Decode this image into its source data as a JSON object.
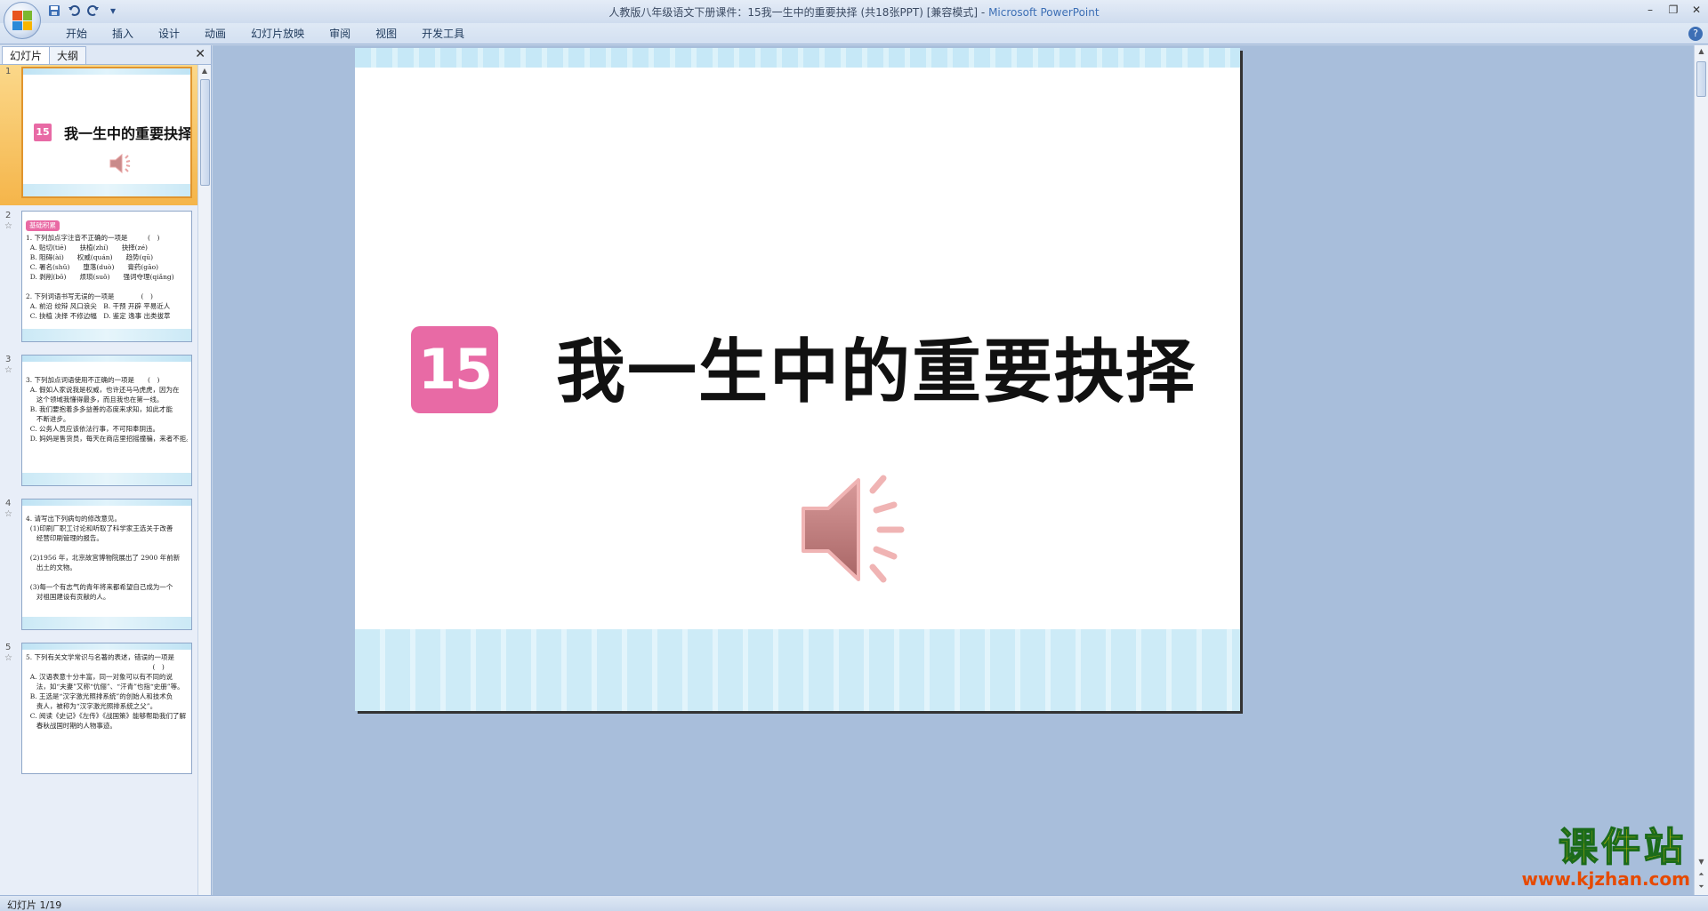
{
  "window": {
    "title": "人教版八年级语文下册课件：15我一生中的重要抉择 (共18张PPT) [兼容模式] - ",
    "app_name": "Microsoft PowerPoint"
  },
  "quick_access": {
    "save_icon": "save-icon",
    "undo_icon": "undo-icon",
    "redo_icon": "redo-icon",
    "customize_icon": "dropdown-icon"
  },
  "ribbon": {
    "tabs": [
      "开始",
      "插入",
      "设计",
      "动画",
      "幻灯片放映",
      "审阅",
      "视图",
      "开发工具"
    ],
    "help": "?"
  },
  "panel": {
    "tabs": [
      "幻灯片",
      "大纲"
    ],
    "close": "✕"
  },
  "thumbnails": [
    {
      "num": "1",
      "title_num": "15",
      "title": "我一生中的重要抉择"
    },
    {
      "num": "2",
      "badge": "基础积累",
      "text": "1. 下列加点字注音不正确的一项是　　　(　)\n  A. 贴切(tiē)　　扶植(zhí)　　抉择(zé)\n  B. 阻碍(ài)　　权威(quán)　　趋势(qū)\n  C. 署名(shǔ)　　堕落(duò)　　膏药(gāo)\n  D. 剥削(bō)　　烦琐(suǒ)　　强词夺理(qiǎng)\n\n2. 下列词语书写无误的一项是　　　　(　)\n  A. 前沿 绞辩 风口浪尖　B. 干预 开辟 平易近人\n  C. 抉植 决择 不修边幅　D. 鉴定 逸事 出类拔萃"
    },
    {
      "num": "3",
      "text": "3. 下列加点词语使用不正确的一项是　　(　)\n  A. 假如人家说我是权威，也许还马马虎虎，因为在\n     这个领域我懂得最多，而且我也在第一线。\n  B. 我们要抱着多多益善的态度来求知，如此才能\n     不断进步。\n  C. 公务人员应该依法行事，不可阳奉阴违。\n  D. 妈妈是售货员，每天在商店里招摇撞骗，来者不拒。"
    },
    {
      "num": "4",
      "text": "4. 请写出下列病句的修改意见。\n  (1)印刷厂职工讨论和听取了科学家王选关于改善\n     经营印刷管理的报告。\n\n  (2)1956 年，北京故宫博物院展出了 2900 年前新\n     出土的文物。\n\n  (3)每一个有志气的青年将来都希望自己成为一个\n     对祖国建设有贡献的人。"
    },
    {
      "num": "5",
      "text": "5. 下列有关文学常识与名著的表述，错误的一项是\n　　　　　　　　　　　　　　　　　　　(　)\n  A. 汉语表意十分丰富，同一对象可以有不同的说\n     法，如“夫妻”又称“伉俪”、“汗青”也指“史册”等。\n  B. 王选是“汉字激光照排系统”的创始人和技术负\n     责人，被称为“汉字激光照排系统之父”。\n  C. 阅读《史记》《左传》《战国策》能够帮助我们了解\n     春秋战国时期的人物事迹。"
    }
  ],
  "slide": {
    "number_badge": "15",
    "title": "我一生中的重要抉择",
    "audio_icon": "speaker-icon"
  },
  "watermark": {
    "main": "课件站",
    "url": "www.kjzhan.com"
  },
  "status": {
    "slide_info": "幻灯片 1/19"
  }
}
